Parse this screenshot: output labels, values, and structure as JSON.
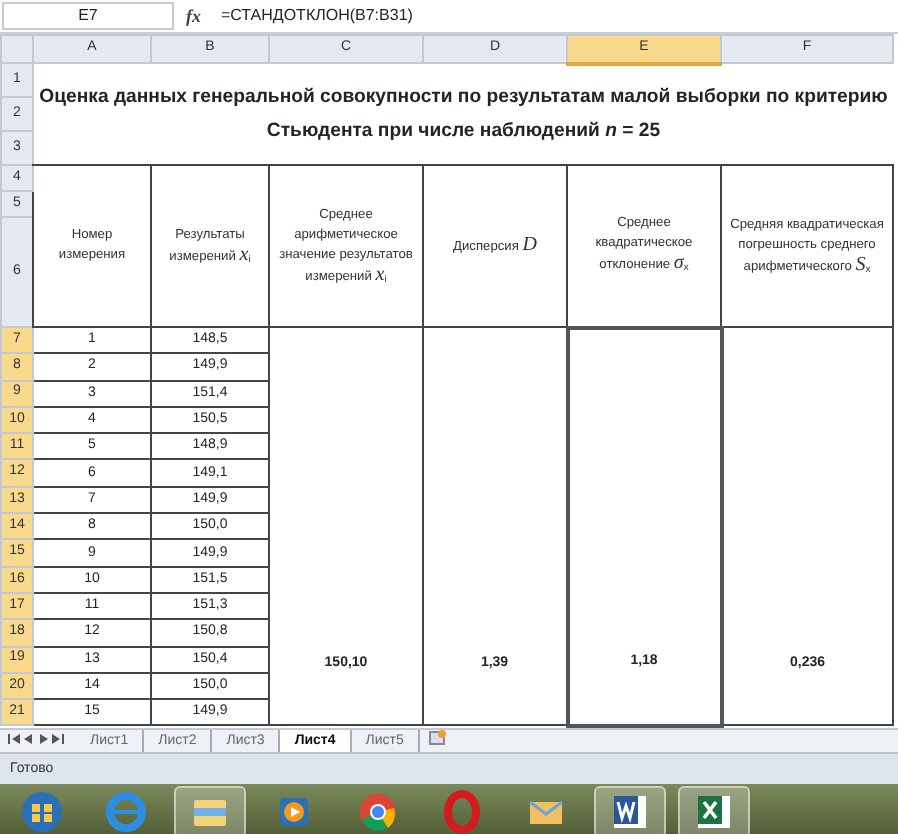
{
  "formula_bar": {
    "cell_ref": "E7",
    "function_button": "fx",
    "formula": "=СТАНДОТКЛОН(B7:B31)"
  },
  "columns": [
    {
      "label": "A",
      "selected": false
    },
    {
      "label": "B",
      "selected": false
    },
    {
      "label": "C",
      "selected": false
    },
    {
      "label": "D",
      "selected": false
    },
    {
      "label": "E",
      "selected": true
    },
    {
      "label": "F",
      "selected": false
    }
  ],
  "title_rows": [
    "1",
    "2",
    "3"
  ],
  "title": "Оценка данных генеральной совокупности по результатам малой выборки по критерию Стьюдента при числе наблюдений *n*  = 25",
  "header_rows": [
    "4",
    "5",
    "6"
  ],
  "headers": [
    "Номер измерения",
    "Результаты измерений *x*$_{i}$",
    "Среднее арифметическое значение результатов измерений *x*$_{i}$",
    "Дисперсия *D*",
    "Среднее квадратическое отклонение *σ*$_{x}$",
    "Средняя квадратическая погрешность среднего арифметического *S*$_{x}$"
  ],
  "rows": [
    {
      "row": "7",
      "selected": true,
      "number": "1",
      "result": "148,5"
    },
    {
      "row": "8",
      "selected": true,
      "number": "2",
      "result": "149,9"
    },
    {
      "row": "9",
      "selected": true,
      "number": "3",
      "result": "151,4"
    },
    {
      "row": "10",
      "selected": true,
      "number": "4",
      "result": "150,5"
    },
    {
      "row": "11",
      "selected": true,
      "number": "5",
      "result": "148,9"
    },
    {
      "row": "12",
      "selected": true,
      "number": "6",
      "result": "149,1"
    },
    {
      "row": "13",
      "selected": true,
      "number": "7",
      "result": "149,9"
    },
    {
      "row": "14",
      "selected": true,
      "number": "8",
      "result": "150,0"
    },
    {
      "row": "15",
      "selected": true,
      "number": "9",
      "result": "149,9"
    },
    {
      "row": "16",
      "selected": true,
      "number": "10",
      "result": "151,5"
    },
    {
      "row": "17",
      "selected": true,
      "number": "11",
      "result": "151,3"
    },
    {
      "row": "18",
      "selected": true,
      "number": "12",
      "result": "150,8"
    },
    {
      "row": "19",
      "selected": true,
      "number": "13",
      "result": "150,4"
    },
    {
      "row": "20",
      "selected": true,
      "number": "14",
      "result": "150,0"
    },
    {
      "row": "21",
      "selected": true,
      "number": "15",
      "result": "149,9"
    }
  ],
  "summary": [
    {
      "value": "150,10",
      "selected": false
    },
    {
      "value": "1,39",
      "selected": false
    },
    {
      "value": "1,18",
      "selected": true
    },
    {
      "value": "0,236",
      "selected": false
    }
  ],
  "sheet_tabs": [
    {
      "label": "Лист1",
      "selected": false
    },
    {
      "label": "Лист2",
      "selected": false
    },
    {
      "label": "Лист3",
      "selected": false
    },
    {
      "label": "Лист4",
      "selected": true
    },
    {
      "label": "Лист5",
      "selected": false
    }
  ],
  "status_bar": "Готово",
  "taskbar": [
    {
      "kind": "start",
      "active": false
    },
    {
      "kind": "ie",
      "active": false
    },
    {
      "kind": "explorer",
      "active": true
    },
    {
      "kind": "player",
      "active": false
    },
    {
      "kind": "chrome",
      "active": false
    },
    {
      "kind": "opera",
      "active": false
    },
    {
      "kind": "mail",
      "active": false
    },
    {
      "kind": "word",
      "active": true
    },
    {
      "kind": "excel",
      "active": true
    }
  ]
}
